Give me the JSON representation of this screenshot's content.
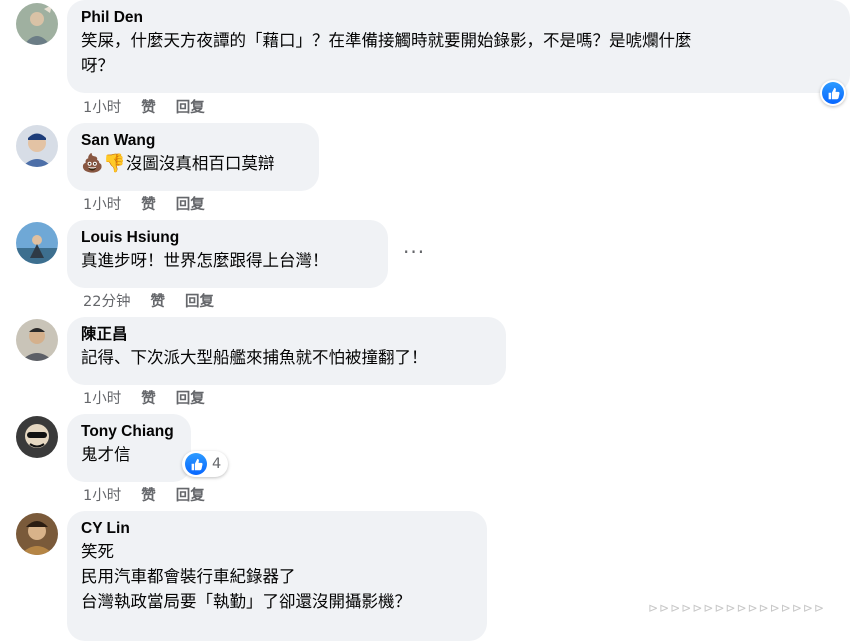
{
  "comments": [
    {
      "author": "Phil Den",
      "lines": [
        "笑屎，什麼天方夜譚的「藉口」？在準備接觸時就要開始錄影，不是嗎？是唬爛什麼",
        "呀？"
      ],
      "time": "1小时",
      "like_label": "赞",
      "reply_label": "回复",
      "reaction": {
        "icon": "thumbs-up-icon",
        "count": ""
      }
    },
    {
      "author": "San Wang",
      "emojis": [
        "💩",
        "👎"
      ],
      "lines": [
        "沒圖沒真相百口莫辯"
      ],
      "time": "1小时",
      "like_label": "赞",
      "reply_label": "回复"
    },
    {
      "author": "Louis Hsiung",
      "lines": [
        "真進步呀！世界怎麼跟得上台灣！"
      ],
      "time": "22分钟",
      "like_label": "赞",
      "reply_label": "回复",
      "more_label": "···"
    },
    {
      "author": "陳正昌",
      "lines": [
        "記得、下次派大型船艦來捕魚就不怕被撞翻了！"
      ],
      "time": "1小时",
      "like_label": "赞",
      "reply_label": "回复"
    },
    {
      "author": "Tony Chiang",
      "lines": [
        "鬼才信"
      ],
      "time": "1小时",
      "like_label": "赞",
      "reply_label": "回复",
      "reaction": {
        "icon": "thumbs-up-icon",
        "count": "4"
      }
    },
    {
      "author": "CY Lin",
      "lines": [
        "笑死",
        "民用汽車都會裝行車紀錄器了",
        "台灣執政當局要「執勤」了卻還沒開攝影機？"
      ]
    }
  ],
  "colors": {
    "bubble": "#f0f2f5",
    "meta": "#65676b",
    "like_blue": "#0866ff"
  },
  "watermark": "⊳⊳⊳⊳⊳⊳⊳⊳⊳⊳⊳⊳⊳⊳⊳⊳"
}
